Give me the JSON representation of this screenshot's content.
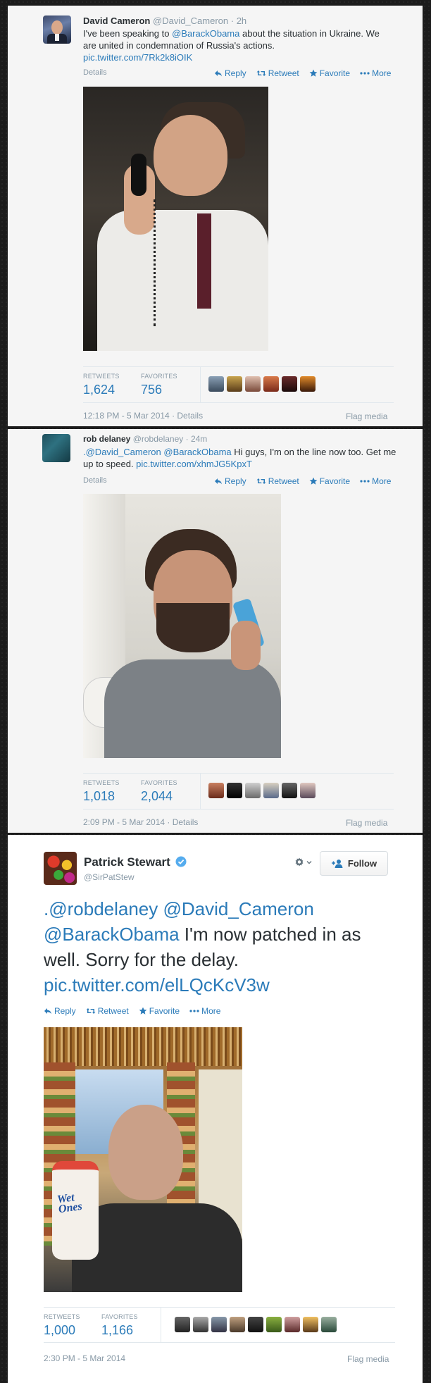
{
  "tweets": [
    {
      "name": "David Cameron",
      "handle": "@David_Cameron",
      "time": "· 2h",
      "text_before": "I've been speaking to ",
      "mention": "@BarackObama",
      "text_after": " about the situation in Ukraine. We are united in condemnation of Russia's actions.",
      "pic_link": "pic.twitter.com/7Rk2k8iOIK",
      "details": "Details",
      "actions": {
        "reply": "Reply",
        "retweet": "Retweet",
        "favorite": "Favorite",
        "more": "More"
      },
      "retweets_label": "RETWEETS",
      "retweets": "1,624",
      "favorites_label": "FAVORITES",
      "favorites": "756",
      "timestamp": "12:18 PM - 5 Mar 2014 · Details",
      "flag": "Flag media"
    },
    {
      "name": "rob delaney",
      "handle": "@robdelaney",
      "time": "· 24m",
      "mention1": ".@David_Cameron",
      "mention2": "@BarackObama",
      "text_after": " Hi guys, I'm on the line now too. Get me up to speed. ",
      "pic_link": "pic.twitter.com/xhmJG5KpxT",
      "details": "Details",
      "actions": {
        "reply": "Reply",
        "retweet": "Retweet",
        "favorite": "Favorite",
        "more": "More"
      },
      "retweets_label": "RETWEETS",
      "retweets": "1,018",
      "favorites_label": "FAVORITES",
      "favorites": "2,044",
      "timestamp": "2:09 PM - 5 Mar 2014 · Details",
      "flag": "Flag media"
    },
    {
      "name": "Patrick Stewart",
      "handle": "@SirPatStew",
      "follow": "Follow",
      "mention1": ".@robdelaney",
      "mention2": "@David_Cameron",
      "mention3": "@BarackObama",
      "text_after": " I'm now patched in as well. Sorry for the delay.",
      "pic_link": "pic.twitter.com/elLQcKcV3w",
      "actions": {
        "reply": "Reply",
        "retweet": "Retweet",
        "favorite": "Favorite",
        "more": "More"
      },
      "retweets_label": "RETWEETS",
      "retweets": "1,000",
      "favorites_label": "FAVORITES",
      "favorites": "1,166",
      "timestamp": "2:30 PM - 5 Mar 2014",
      "flag": "Flag media"
    }
  ],
  "colors": {
    "link": "#2b7bb9",
    "muted": "#8899a6",
    "verified": "#55acee"
  },
  "icons": [
    "reply-icon",
    "retweet-icon",
    "star-icon",
    "more-icon",
    "gear-icon",
    "add-user-icon",
    "verified-icon"
  ]
}
